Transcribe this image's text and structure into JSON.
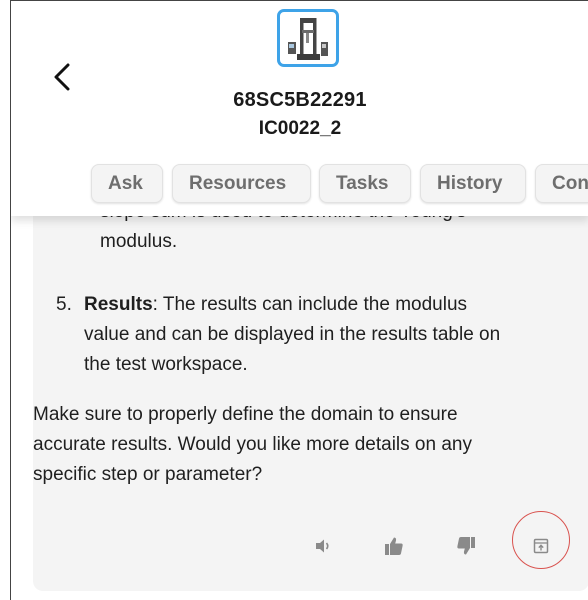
{
  "header": {
    "back_icon": "chevron-left-icon",
    "device_icon": "testing-machine-icon",
    "serial": "68SC5B22291",
    "model": "IC0022_2",
    "tabs": [
      {
        "label": "Ask"
      },
      {
        "label": "Resources"
      },
      {
        "label": "Tasks"
      },
      {
        "label": "History"
      },
      {
        "label": "Con"
      }
    ]
  },
  "message": {
    "cut_line": "slope sum is used to determine the Young’s",
    "line_modulus": "modulus.",
    "item5_number": "5.",
    "item5_bold": "Results",
    "item5_line1": ": The results can include the modulus",
    "item5_line2": "value and can be displayed in the results table on",
    "item5_line3": "the test workspace.",
    "closing_line1": "Make sure to properly define the domain to ensure",
    "closing_line2": "accurate results. Would you like more details on any",
    "closing_line3": "specific step or parameter?"
  },
  "actions": {
    "speak_icon": "speaker-icon",
    "like_icon": "thumbs-up-icon",
    "dislike_icon": "thumbs-down-icon",
    "export_icon": "export-icon"
  },
  "colors": {
    "accent_blue": "#3ea3e8",
    "highlight_red": "#d9534f",
    "bubble_bg": "#f4f4f4",
    "icon_gray": "#8a8a8a"
  }
}
